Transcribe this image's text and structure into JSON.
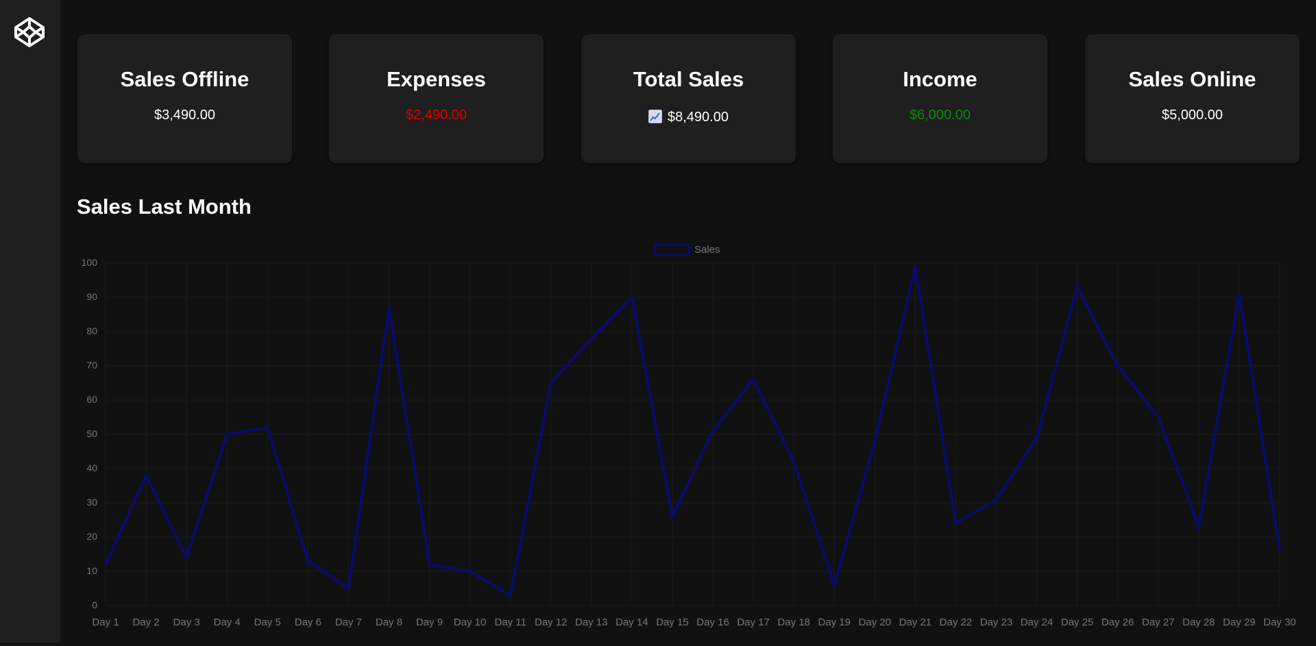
{
  "sidebar": {
    "logo_icon": "codepen-cube-icon"
  },
  "cards": [
    {
      "title": "Sales Offline",
      "value": "$3,490.00",
      "color": "#ffffff"
    },
    {
      "title": "Expenses",
      "value": "$2,490.00",
      "color": "#dd0000"
    },
    {
      "title": "Total Sales",
      "value": "$8,490.00",
      "color": "#ffffff",
      "icon": "chart-increasing-icon"
    },
    {
      "title": "Income",
      "value": "$6,000.00",
      "color": "#0b8a0b"
    },
    {
      "title": "Sales Online",
      "value": "$5,000.00",
      "color": "#ffffff"
    }
  ],
  "section": {
    "title": "Sales Last Month"
  },
  "chart_data": {
    "type": "line",
    "title": "",
    "xlabel": "",
    "ylabel": "",
    "legend_position": "top-center",
    "grid": true,
    "ylim": [
      0,
      100
    ],
    "yticks": [
      0,
      10,
      20,
      30,
      40,
      50,
      60,
      70,
      80,
      90,
      100
    ],
    "line_color": "#0a0a6e",
    "categories": [
      "Day 1",
      "Day 2",
      "Day 3",
      "Day 4",
      "Day 5",
      "Day 6",
      "Day 7",
      "Day 8",
      "Day 9",
      "Day 10",
      "Day 11",
      "Day 12",
      "Day 13",
      "Day 14",
      "Day 15",
      "Day 16",
      "Day 17",
      "Day 18",
      "Day 19",
      "Day 20",
      "Day 21",
      "Day 22",
      "Day 23",
      "Day 24",
      "Day 25",
      "Day 26",
      "Day 27",
      "Day 28",
      "Day 29",
      "Day 30"
    ],
    "series": [
      {
        "name": "Sales",
        "values": [
          12,
          38,
          14,
          50,
          52,
          13,
          5,
          87,
          12,
          10,
          3,
          65,
          78,
          90,
          26,
          51,
          66,
          42,
          6,
          48,
          99,
          24,
          31,
          49,
          93,
          70,
          55,
          23,
          91,
          16
        ]
      }
    ]
  }
}
